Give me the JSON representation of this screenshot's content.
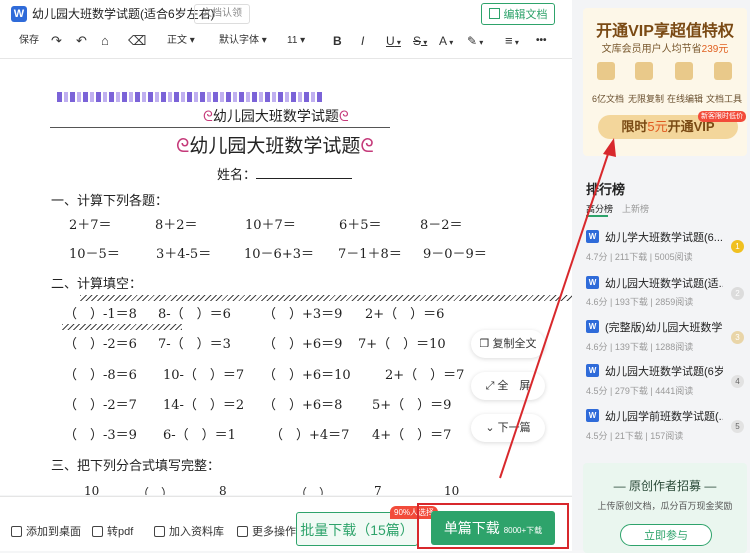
{
  "header": {
    "app_icon": "W",
    "doc_title": "幼儿园大班数学试题(适合6岁左右)",
    "cert_badge": "文档认领",
    "edit_button": "编辑文档"
  },
  "toolbar": {
    "save": "保存",
    "style_select": "正文",
    "font_select": "默认字体",
    "size_select": "11",
    "bold": "B",
    "italic": "I",
    "underline": "U",
    "strike": "S",
    "font_color": "A",
    "highlight": "✎",
    "align": "≡",
    "more": "•••"
  },
  "document": {
    "banner": "幼儿园大班数学试题",
    "title": "幼儿园大班数学试题",
    "name_label": "姓名：",
    "section1": "一、计算下列各题：",
    "row1": [
      "2＋7＝",
      "8＋2＝",
      "10＋7＝",
      "6＋5＝",
      "8－2＝"
    ],
    "row2": [
      "10－5＝",
      "3＋4-5＝",
      "10－6+3＝",
      "7－1＋8＝",
      "9－0－9＝"
    ],
    "section2": "二、计算填空：",
    "fill_rows": [
      [
        "（　）-1＝8",
        "8-（　）＝6",
        "（　）+3＝9",
        "2+（　）＝6"
      ],
      [
        "（　）-2＝6",
        "7-（　）＝3",
        "（　）+6＝9",
        "7+（　）＝10"
      ],
      [
        "（　）-8＝6",
        "10-（　）＝7",
        "（　）+6＝10",
        "2+（　）＝7"
      ],
      [
        "（　）-2＝7",
        "14-（　）＝2",
        "（　）+6＝8",
        "5+（　）＝9"
      ],
      [
        "（　）-3＝9",
        "6-（　）＝1",
        "（　）+4＝7",
        "4+（　）＝7"
      ]
    ],
    "section3": "三、把下列分合式填写完整：",
    "tree_tops": [
      "10",
      "（　）",
      "8",
      "（　）",
      "7",
      "10"
    ]
  },
  "float_buttons": {
    "copy": "复制全文",
    "fullscreen": "全　屏",
    "next": "下一篇"
  },
  "bottom_bar": {
    "add_desktop": "添加到桌面",
    "to_pdf": "转pdf",
    "add_library": "加入资料库",
    "more_ops": "更多操作",
    "batch_download": "批量下载（15篇）",
    "batch_badge": "90%人选择",
    "single_download": "单篇下载",
    "single_count": "8000+下载"
  },
  "vip": {
    "title": "开通VIP享超值特权",
    "subtitle_prefix": "文库会员用户人均节省",
    "saving": "239元",
    "features": [
      "6亿文档",
      "无限复制",
      "在线编辑",
      "文档工具"
    ],
    "button_prefix": "限时",
    "button_price": "5元",
    "button_suffix": "开通VIP",
    "badge": "新客限时低价"
  },
  "ranking": {
    "title": "排行榜",
    "tabs": [
      "高分榜",
      "上新榜"
    ],
    "items": [
      {
        "title": "幼儿学大班数学试题(6...",
        "score": "4.7分",
        "downloads": "211下载",
        "reads": "5005阅读",
        "rank": "1"
      },
      {
        "title": "幼儿园大班数学试题(适...",
        "score": "4.6分",
        "downloads": "193下载",
        "reads": "2859阅读",
        "rank": "2"
      },
      {
        "title": "(完整版)幼儿园大班数学...",
        "score": "4.6分",
        "downloads": "139下载",
        "reads": "1288阅读",
        "rank": "3"
      },
      {
        "title": "幼儿园大班数学试题(6岁)",
        "score": "4.5分",
        "downloads": "279下载",
        "reads": "4441阅读",
        "rank": "4"
      },
      {
        "title": "幼儿园学前班数学试题(...",
        "score": "4.5分",
        "downloads": "21下载",
        "reads": "157阅读",
        "rank": "5"
      }
    ]
  },
  "creator": {
    "title": "原创作者招募",
    "subtitle": "上传原创文档，瓜分百万现金奖励",
    "button": "立即参与"
  },
  "colors": {
    "accent_green": "#2ea36b",
    "vip_gold": "#f3d69b",
    "annotation_red": "#d8282c"
  }
}
